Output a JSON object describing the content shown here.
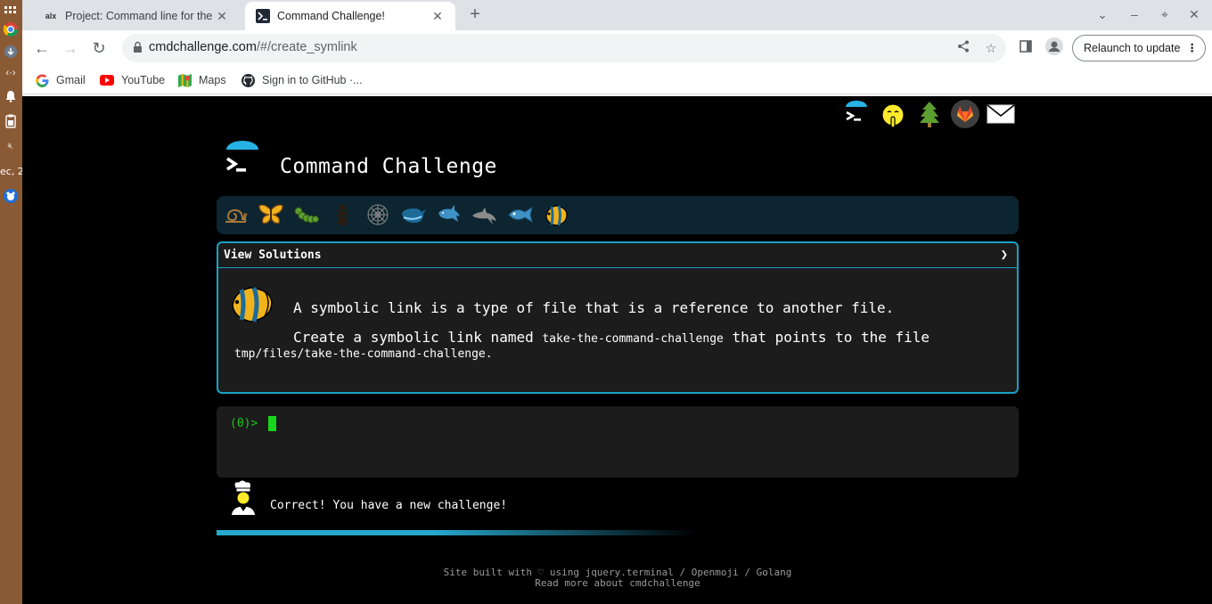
{
  "os_panel": {
    "clock_text": "ec, 2",
    "icons": [
      "chrome-icon",
      "download-icon",
      "code-icon",
      "bell-icon",
      "clipboard-icon",
      "volume-muted-icon",
      "app-icon"
    ]
  },
  "browser": {
    "tabs": [
      {
        "favicon": "alx",
        "title": "Project: Command line for the",
        "active": false
      },
      {
        "favicon": "terminal",
        "title": "Command Challenge!",
        "active": true
      }
    ],
    "url_host": "cmdchallenge.com",
    "url_path": "/#/create_symlink",
    "relaunch_label": "Relaunch to update",
    "bookmarks": [
      {
        "icon": "google-icon",
        "label": "Gmail"
      },
      {
        "icon": "youtube-icon",
        "label": "YouTube"
      },
      {
        "icon": "maps-icon",
        "label": "Maps"
      },
      {
        "icon": "github-icon",
        "label": "Sign in to GitHub ·..."
      }
    ]
  },
  "page": {
    "brand_title": "Command Challenge",
    "header_icons": [
      "cmd-logo-icon",
      "shushing-face-icon",
      "tree-icon",
      "gitlab-icon",
      "envelope-icon"
    ],
    "emoji_bar": [
      "snail-icon",
      "butterfly-icon",
      "caterpillar-icon",
      "ant-icon",
      "spider-web-icon",
      "whale-icon",
      "shark-icon",
      "dolphin-icon",
      "fish-icon",
      "tropical-fish-icon"
    ],
    "challenge": {
      "header": "View Solutions",
      "arrow": "❯",
      "line1": "A symbolic link is a type of file that is a reference to another file.",
      "line2_prefix": "Create a symbolic link named ",
      "line2_code": "take-the-command-challenge",
      "line2_suffix": " that points to the file",
      "line3": "tmp/files/take-the-command-challenge."
    },
    "terminal": {
      "prompt": "(0)> "
    },
    "feedback": "Correct! You have a new challenge!",
    "progress": 0.45,
    "footer": {
      "line1": "Site built with ♡ using jquery.terminal / Openmoji / Golang",
      "line2": "Read more about cmdchallenge"
    },
    "colors": {
      "accent": "#1aa2c4",
      "prompt": "#15c91a",
      "panel": "#1c1c1c",
      "emoji_bar": "#0c2530"
    }
  }
}
